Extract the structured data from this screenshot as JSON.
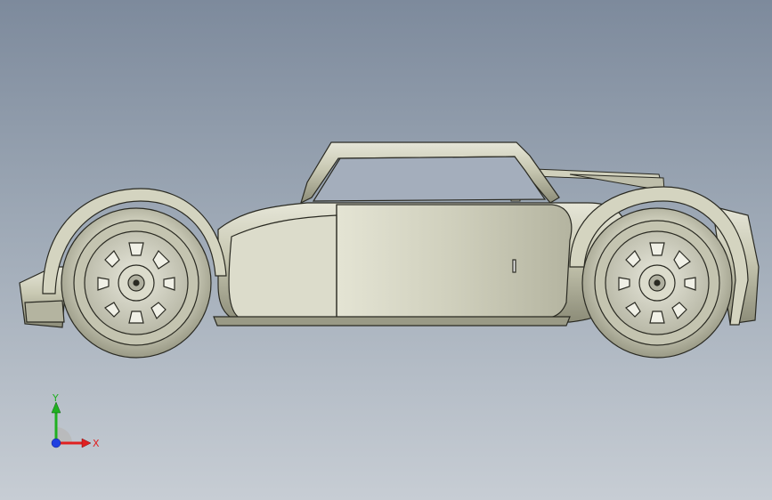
{
  "viewport": {
    "background_top": "#7d8a9c",
    "background_bottom": "#c7cdd4"
  },
  "model": {
    "body_color": "#c9c9b4",
    "edge_color": "#2a2a22",
    "wheel_color": "#d4d4c2"
  },
  "triad": {
    "x_label": "X",
    "y_label": "Y",
    "x_color": "#e02020",
    "y_color": "#20b020",
    "z_color": "#2040e0",
    "icon": "coordinate-triad-icon"
  }
}
